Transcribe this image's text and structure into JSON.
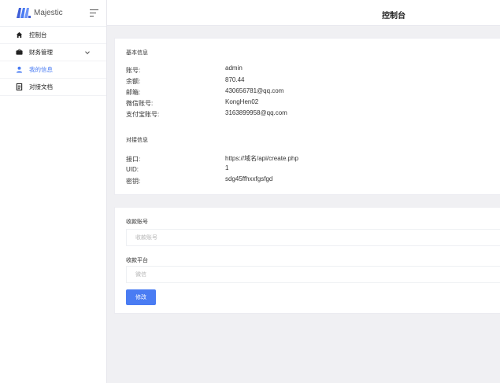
{
  "app": {
    "name": "Majestic"
  },
  "header": {
    "title": "控制台"
  },
  "sidebar": {
    "items": [
      {
        "label": "控制台",
        "icon": "home-icon"
      },
      {
        "label": "财务管理",
        "icon": "wallet-icon",
        "has_submenu": true
      },
      {
        "label": "我的信息",
        "icon": "user-icon",
        "active": true
      },
      {
        "label": "对接文档",
        "icon": "document-icon"
      }
    ]
  },
  "basic_info": {
    "title": "基本信息",
    "rows": [
      {
        "label": "账号:",
        "value": "admin"
      },
      {
        "label": "余额:",
        "value": "870.44"
      },
      {
        "label": "邮箱:",
        "value": "430656781@qq.com"
      },
      {
        "label": "微信账号:",
        "value": "KongHen02"
      },
      {
        "label": "支付宝账号:",
        "value": "3163899958@qq.com"
      }
    ]
  },
  "api_info": {
    "title": "对接信息",
    "rows": [
      {
        "label": "接口:",
        "value": "https://域名/api/create.php"
      },
      {
        "label": "UID:",
        "value": "1"
      },
      {
        "label": "密钥:",
        "value": "sdg45ffhxxfgsfgd"
      }
    ]
  },
  "form": {
    "account_label": "收款账号",
    "account_placeholder": "收款账号",
    "platform_label": "收款平台",
    "platform_value": "微信",
    "submit_label": "修改"
  },
  "colors": {
    "accent": "#4a7cf3",
    "background": "#f0f0f3",
    "card": "#ffffff"
  }
}
